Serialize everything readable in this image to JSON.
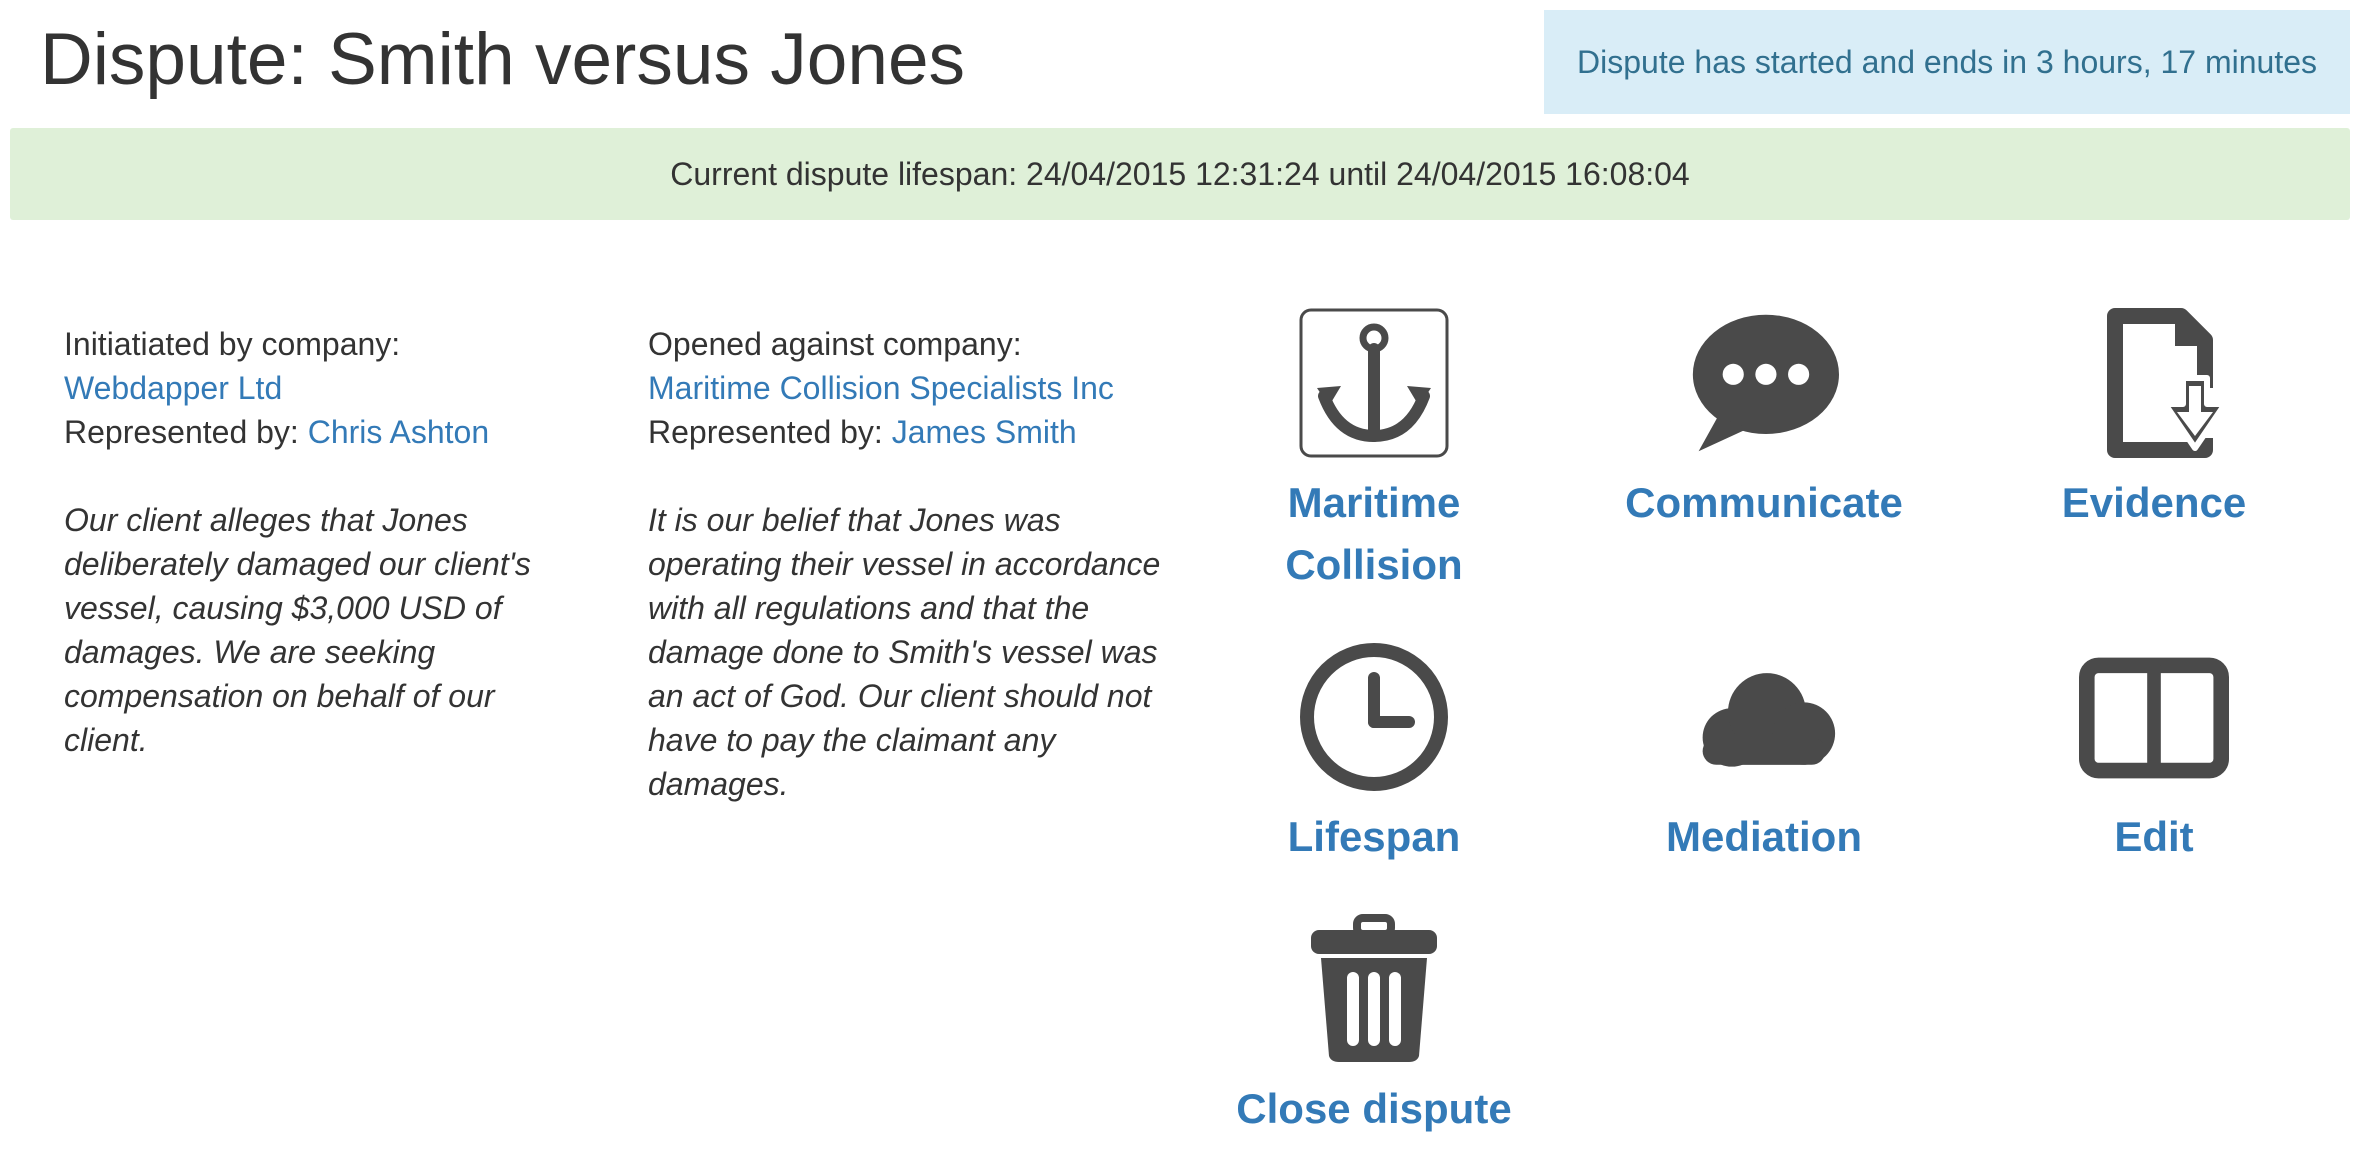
{
  "header": {
    "title": "Dispute: Smith versus Jones",
    "status": "Dispute has started and ends in 3 hours, 17 minutes"
  },
  "lifespan_bar": {
    "text": "Current dispute lifespan: 24/04/2015 12:31:24 until 24/04/2015 16:08:04"
  },
  "initiator": {
    "company_label": "Initiatiated by company:",
    "company_name": "Webdapper Ltd",
    "represented_label": "Represented by:",
    "representative": "Chris Ashton",
    "statement": "Our client alleges that Jones deliberately damaged our client's vessel, causing $3,000 USD of damages. We are seeking compensation on behalf of our client."
  },
  "respondent": {
    "company_label": "Opened against company:",
    "company_name": "Maritime Collision Specialists Inc",
    "represented_label": "Represented by:",
    "representative": "James Smith",
    "statement": "It is our belief that Jones was operating their vessel in accordance with all regulations and that the damage done to Smith's vessel was an act of God. Our client should not have to pay the claimant any damages."
  },
  "actions": {
    "maritime_collision": {
      "line1": "Maritime",
      "line2": "Collision",
      "icon": "anchor-icon"
    },
    "communicate": {
      "label": "Communicate",
      "icon": "speech-bubble-icon"
    },
    "evidence": {
      "label": "Evidence",
      "icon": "file-download-icon"
    },
    "lifespan": {
      "label": "Lifespan",
      "icon": "clock-icon"
    },
    "mediation": {
      "label": "Mediation",
      "icon": "cloud-icon"
    },
    "edit": {
      "label": "Edit",
      "icon": "book-icon"
    },
    "close_dispute": {
      "label": "Close dispute",
      "icon": "trash-icon"
    }
  },
  "colors": {
    "link": "#337ab7",
    "icon": "#4a4a4a",
    "info_bg": "#d9edf7",
    "info_text": "#31708f",
    "success_bg": "#dff0d8",
    "text": "#333333"
  }
}
